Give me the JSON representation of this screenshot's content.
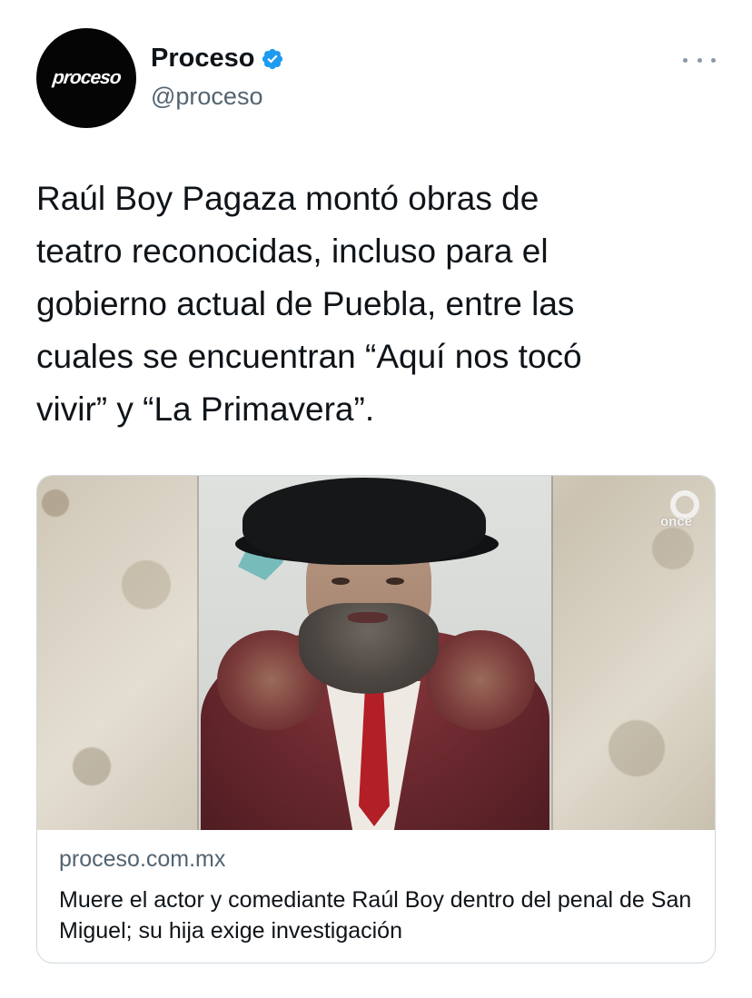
{
  "author": {
    "name": "Proceso",
    "handle": "@proceso",
    "avatar_text": "proceso",
    "verified": true
  },
  "menu": {
    "icon": "more-horizontal-icon"
  },
  "tweet": {
    "text": "Raúl Boy Pagaza montó obras de\nteatro reconocidas, incluso para el\ngobierno actual de Puebla, entre las\ncuales se encuentran “Aquí nos tocó\nvivir” y “La Primavera”."
  },
  "card": {
    "watermark": "once",
    "domain": "proceso.com.mx",
    "title": "Muere el actor y comediante Raúl Boy dentro del penal de San Miguel; su hija exige investigación"
  },
  "colors": {
    "verified_blue": "#1d9bf0",
    "secondary_text": "#536471",
    "border": "#cfd9de"
  }
}
